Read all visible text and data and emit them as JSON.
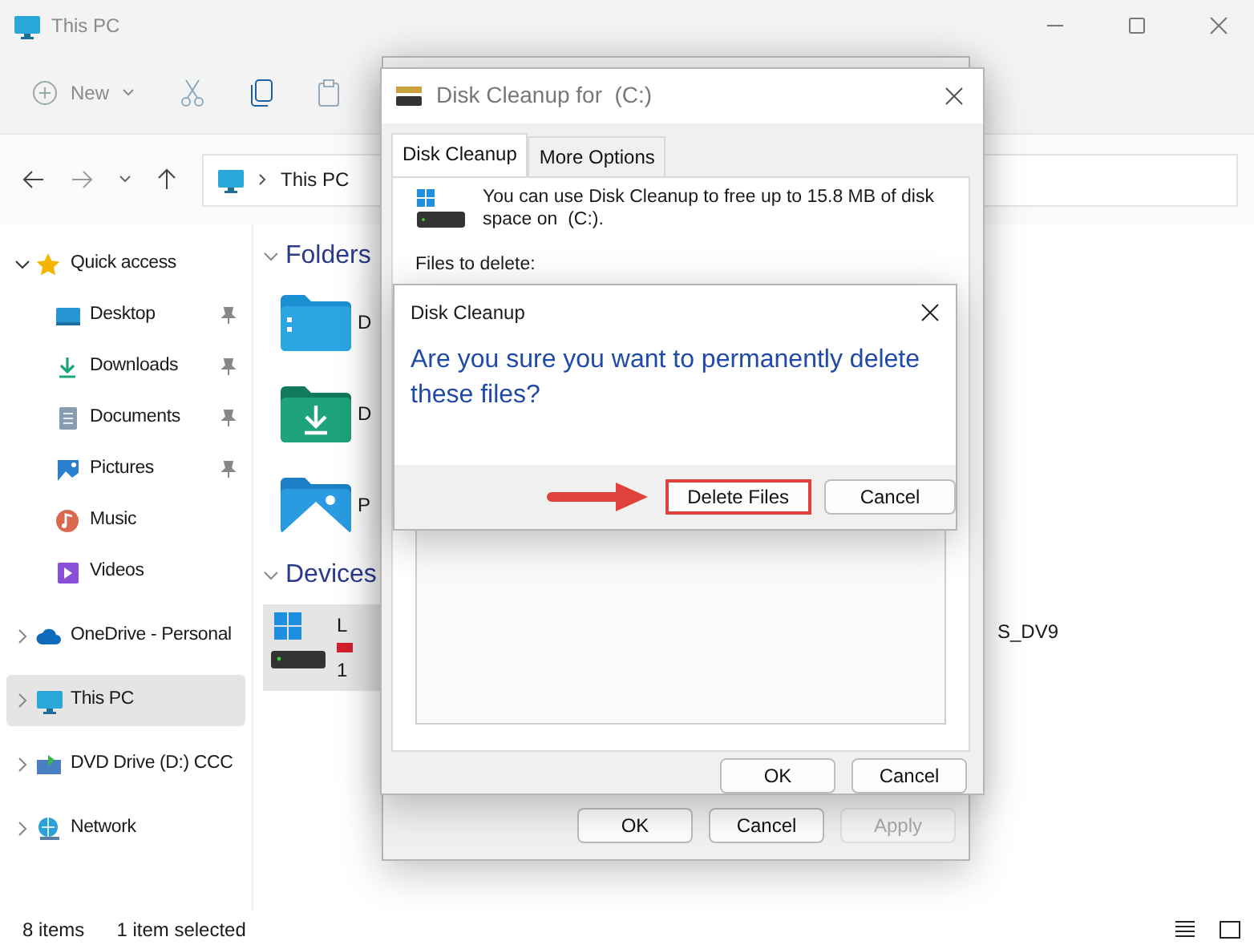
{
  "explorer": {
    "title": "This PC",
    "toolbar": {
      "new_label": "New"
    },
    "address": {
      "path": "This PC"
    },
    "sidebar": {
      "items": [
        {
          "label": "Quick access",
          "expanded": true,
          "selected": false,
          "children": [
            {
              "label": "Desktop",
              "pinned": true,
              "selected": false
            },
            {
              "label": "Downloads",
              "pinned": true,
              "selected": false
            },
            {
              "label": "Documents",
              "pinned": true,
              "selected": false
            },
            {
              "label": "Pictures",
              "pinned": true,
              "selected": false
            },
            {
              "label": "Music",
              "pinned": false,
              "selected": false
            },
            {
              "label": "Videos",
              "pinned": false,
              "selected": false
            }
          ]
        },
        {
          "label": "OneDrive - Personal",
          "expanded": false,
          "selected": false
        },
        {
          "label": "This PC",
          "expanded": false,
          "selected": true
        },
        {
          "label": "DVD Drive (D:) CCC",
          "expanded": false,
          "selected": false
        },
        {
          "label": "Network",
          "expanded": false,
          "selected": false
        }
      ]
    },
    "content": {
      "folders": {
        "title": "Folders",
        "items": [
          {
            "label": "D"
          },
          {
            "label": "D"
          },
          {
            "label": "P"
          }
        ]
      },
      "devices": {
        "title": "Devices",
        "items": [
          {
            "label": "L",
            "detail": "1",
            "selected": true
          },
          {
            "label": "S_DV9",
            "selected": false
          }
        ]
      }
    },
    "status_bar": {
      "count": "8 items",
      "selection": "1 item selected"
    }
  },
  "properties_window": {
    "buttons": [
      {
        "label": "OK",
        "disabled": false
      },
      {
        "label": "Cancel",
        "disabled": false
      },
      {
        "label": "Apply",
        "disabled": true
      }
    ]
  },
  "cleanup_window": {
    "title": "Disk Cleanup for  (C:)",
    "tabs": [
      {
        "label": "Disk Cleanup",
        "selected": true
      },
      {
        "label": "More Options",
        "selected": false
      }
    ],
    "description": "You can use Disk Cleanup to free up to 15.8 MB of disk space on  (C:).",
    "files_label": "Files to delete:",
    "buttons": [
      {
        "label": "OK"
      },
      {
        "label": "Cancel"
      }
    ]
  },
  "confirm_dialog": {
    "title": "Disk Cleanup",
    "message": "Are you sure you want to permanently delete these files?",
    "buttons": [
      {
        "label": "Delete Files",
        "highlighted": true
      },
      {
        "label": "Cancel",
        "highlighted": false
      }
    ]
  }
}
